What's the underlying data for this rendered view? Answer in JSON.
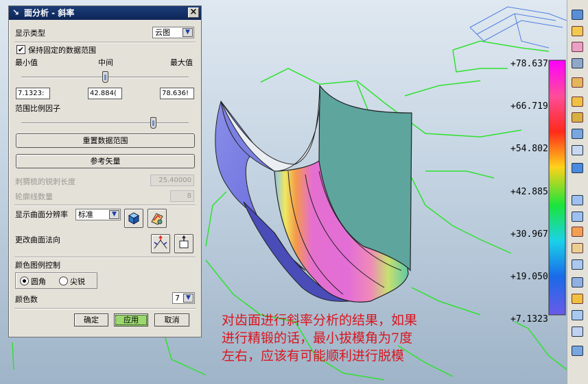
{
  "dialog": {
    "title": "面分析 - 斜率",
    "display_type_label": "显示类型",
    "display_type_value": "云图",
    "keep_range_label": "保持固定的数据范围",
    "keep_range_checked": true,
    "min_label": "最小值",
    "mid_label": "中间",
    "max_label": "最大值",
    "min_value": "7.1323:",
    "mid_value": "42.884(",
    "max_value": "78.636!",
    "scale_factor_label": "范围比例因子",
    "reset_range_button": "重置数据范围",
    "ref_vector_button": "参考矢量",
    "hedgehog_length_label": "刺猬梳的锐刺长度",
    "hedgehog_length_value": "25.40000",
    "contour_count_label": "轮廓线数量",
    "contour_count_value": "8",
    "surface_resolution_label": "显示曲面分辨率",
    "surface_resolution_value": "标准",
    "change_normal_label": "更改曲面法向",
    "legend_control_label": "颜色图例控制",
    "radio_round": "圆角",
    "radio_sharp": "尖锐",
    "radio_selected": "round",
    "color_count_label": "颜色数",
    "color_count_value": "7",
    "ok_button": "确定",
    "apply_button": "应用",
    "cancel_button": "取消"
  },
  "legend": {
    "values": [
      "+78.637",
      "+66.719",
      "+54.802",
      "+42.885",
      "+30.967",
      "+19.050",
      "+7.1323"
    ]
  },
  "annotation": {
    "lines": [
      "对齿面进行斜率分析的结果，如果",
      "进行精锻的话，最小拔模角为7度",
      "左右，应该有可能顺利进行脱模"
    ]
  },
  "colors": {
    "title_bar": "#1c3d79",
    "annotation": "#d9161e",
    "edge_lines": "#2fe12f"
  }
}
